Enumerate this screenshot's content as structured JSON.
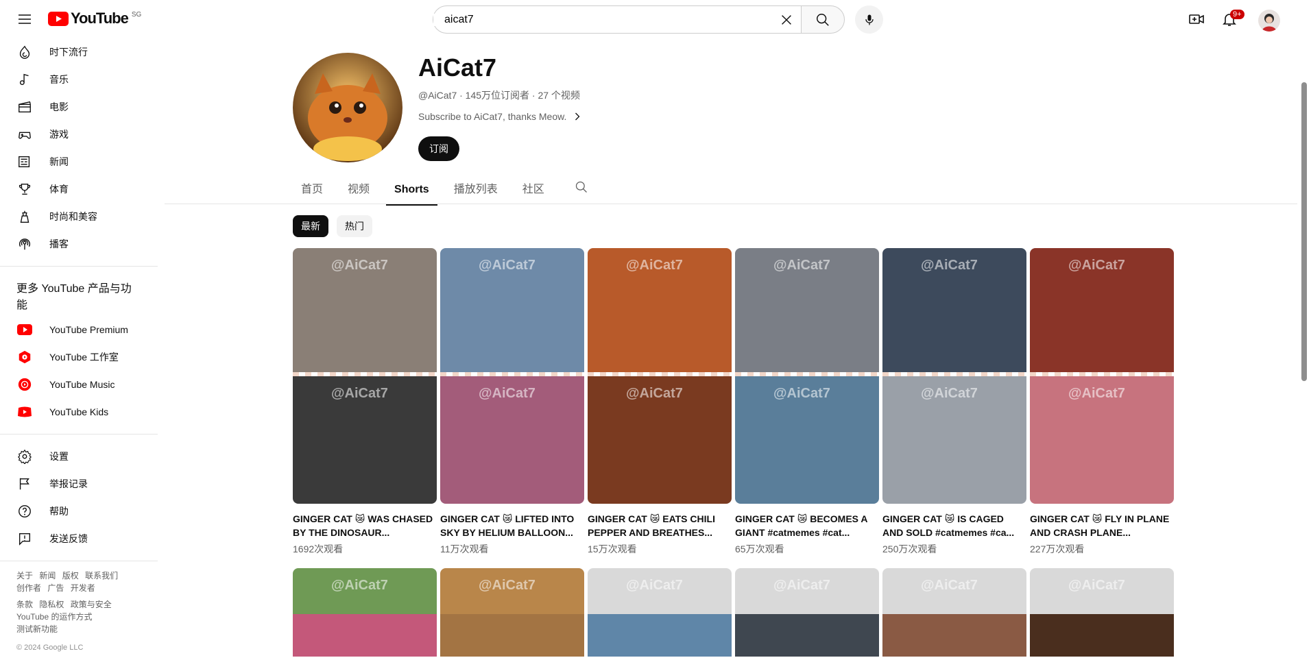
{
  "header": {
    "logo_text": "YouTube",
    "region": "SG",
    "search_value": "aicat7",
    "notification_count": "9+"
  },
  "sidebar": {
    "explore": [
      {
        "label": "时下流行",
        "icon": "trending-icon"
      },
      {
        "label": "音乐",
        "icon": "music-icon"
      },
      {
        "label": "电影",
        "icon": "movie-icon"
      },
      {
        "label": "游戏",
        "icon": "gaming-icon"
      },
      {
        "label": "新闻",
        "icon": "news-icon"
      },
      {
        "label": "体育",
        "icon": "trophy-icon"
      },
      {
        "label": "时尚和美容",
        "icon": "fashion-icon"
      },
      {
        "label": "播客",
        "icon": "podcast-icon"
      }
    ],
    "more_heading": "更多 YouTube 产品与功能",
    "more": [
      {
        "label": "YouTube Premium",
        "icon": "youtube-premium-icon"
      },
      {
        "label": "YouTube 工作室",
        "icon": "youtube-studio-icon"
      },
      {
        "label": "YouTube Music",
        "icon": "youtube-music-icon"
      },
      {
        "label": "YouTube Kids",
        "icon": "youtube-kids-icon"
      }
    ],
    "settings": [
      {
        "label": "设置",
        "icon": "gear-icon"
      },
      {
        "label": "举报记录",
        "icon": "flag-icon"
      },
      {
        "label": "帮助",
        "icon": "help-icon"
      },
      {
        "label": "发送反馈",
        "icon": "feedback-icon"
      }
    ],
    "footer_row1": [
      "关于",
      "新闻",
      "版权",
      "联系我们"
    ],
    "footer_row2": [
      "创作者",
      "广告",
      "开发者"
    ],
    "footer_row3": [
      "条款",
      "隐私权",
      "政策与安全"
    ],
    "footer_row4": "YouTube 的运作方式",
    "footer_row5": "测试新功能",
    "copyright": "© 2024 Google LLC"
  },
  "channel": {
    "name": "AiCat7",
    "meta": "@AiCat7 · 145万位订阅者 · 27 个视频",
    "description": "Subscribe to AiCat7, thanks Meow.",
    "subscribe_label": "订阅"
  },
  "tabs": [
    "首页",
    "视频",
    "Shorts",
    "播放列表",
    "社区"
  ],
  "active_tab": "Shorts",
  "chips": [
    "最新",
    "热门"
  ],
  "watermark": "@AiCat7",
  "shorts": [
    {
      "title": "GINGER CAT 😿 WAS CHASED BY THE DINOSAUR...",
      "views": "1692次观看",
      "colors": [
        "#8a7f76",
        "#3a3a3a"
      ]
    },
    {
      "title": "GINGER CAT 😿 LIFTED INTO SKY BY HELIUM BALLOON...",
      "views": "11万次观看",
      "colors": [
        "#6e8aa8",
        "#a35c7a"
      ]
    },
    {
      "title": "GINGER CAT 😿 EATS CHILI PEPPER AND BREATHES...",
      "views": "15万次观看",
      "colors": [
        "#b85a2a",
        "#7a3a20"
      ]
    },
    {
      "title": "GINGER CAT 😿 BECOMES A GIANT #catmemes #cat...",
      "views": "65万次观看",
      "colors": [
        "#7a7e86",
        "#5a7e9a"
      ]
    },
    {
      "title": "GINGER CAT 😿 IS CAGED AND SOLD #catmemes #ca...",
      "views": "250万次观看",
      "colors": [
        "#3d4a5c",
        "#9aa0a8"
      ]
    },
    {
      "title": "GINGER CAT 😿 FLY IN PLANE AND CRASH PLANE...",
      "views": "227万次观看",
      "colors": [
        "#8a3428",
        "#c7737e"
      ]
    }
  ],
  "shorts_row2": [
    {
      "colors": [
        "#6f9a55",
        "#c4587a"
      ]
    },
    {
      "colors": [
        "#b9864a",
        "#a37443"
      ]
    },
    {
      "colors": [
        "#d9d9d9",
        "#5f86a8"
      ]
    },
    {
      "colors": [
        "#d9d9d9",
        "#3f4750"
      ]
    },
    {
      "colors": [
        "#d9d9d9",
        "#8a5a44"
      ]
    },
    {
      "colors": [
        "#d9d9d9",
        "#4a2e1e"
      ]
    }
  ]
}
